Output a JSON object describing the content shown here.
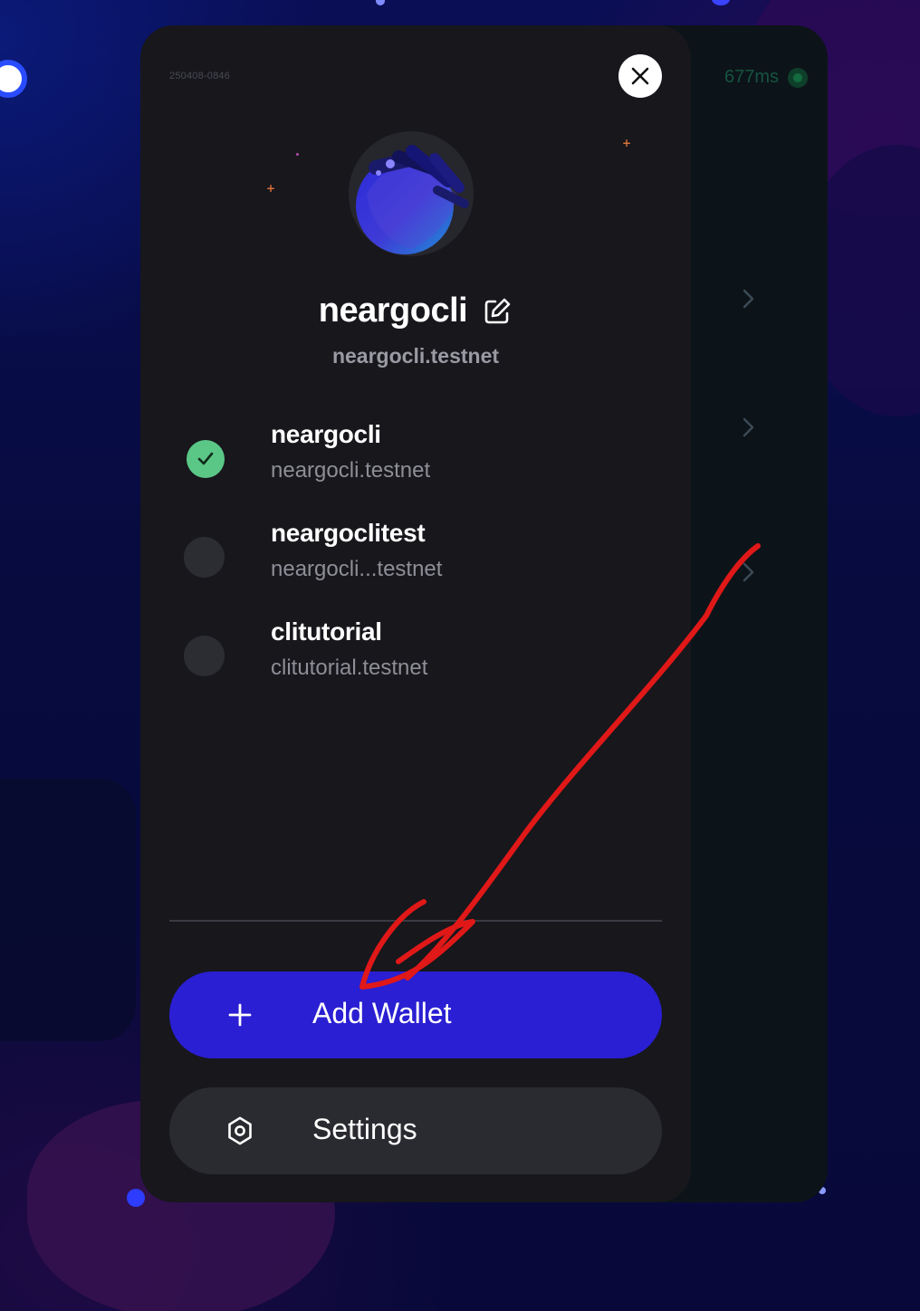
{
  "build_id": "250408-0846",
  "latency": "677ms",
  "profile": {
    "name": "neargocli",
    "account_id": "neargocli.testnet"
  },
  "accounts": [
    {
      "name": "neargocli",
      "account_id": "neargocli.testnet",
      "selected": true
    },
    {
      "name": "neargoclitest",
      "account_id": "neargocli...testnet",
      "selected": false
    },
    {
      "name": "clitutorial",
      "account_id": "clitutorial.testnet",
      "selected": false
    }
  ],
  "actions": {
    "add_wallet_label": "Add Wallet",
    "settings_label": "Settings"
  },
  "colors": {
    "accent": "#2a1fd2",
    "selected_check": "#5bc787",
    "sheet_bg": "#17171c",
    "annotation": "#e01818"
  },
  "icons": {
    "close": "close-icon",
    "edit": "edit-icon",
    "check": "check-icon",
    "plus": "plus-icon",
    "settings": "gear-icon",
    "chevron": "chevron-right-icon"
  }
}
